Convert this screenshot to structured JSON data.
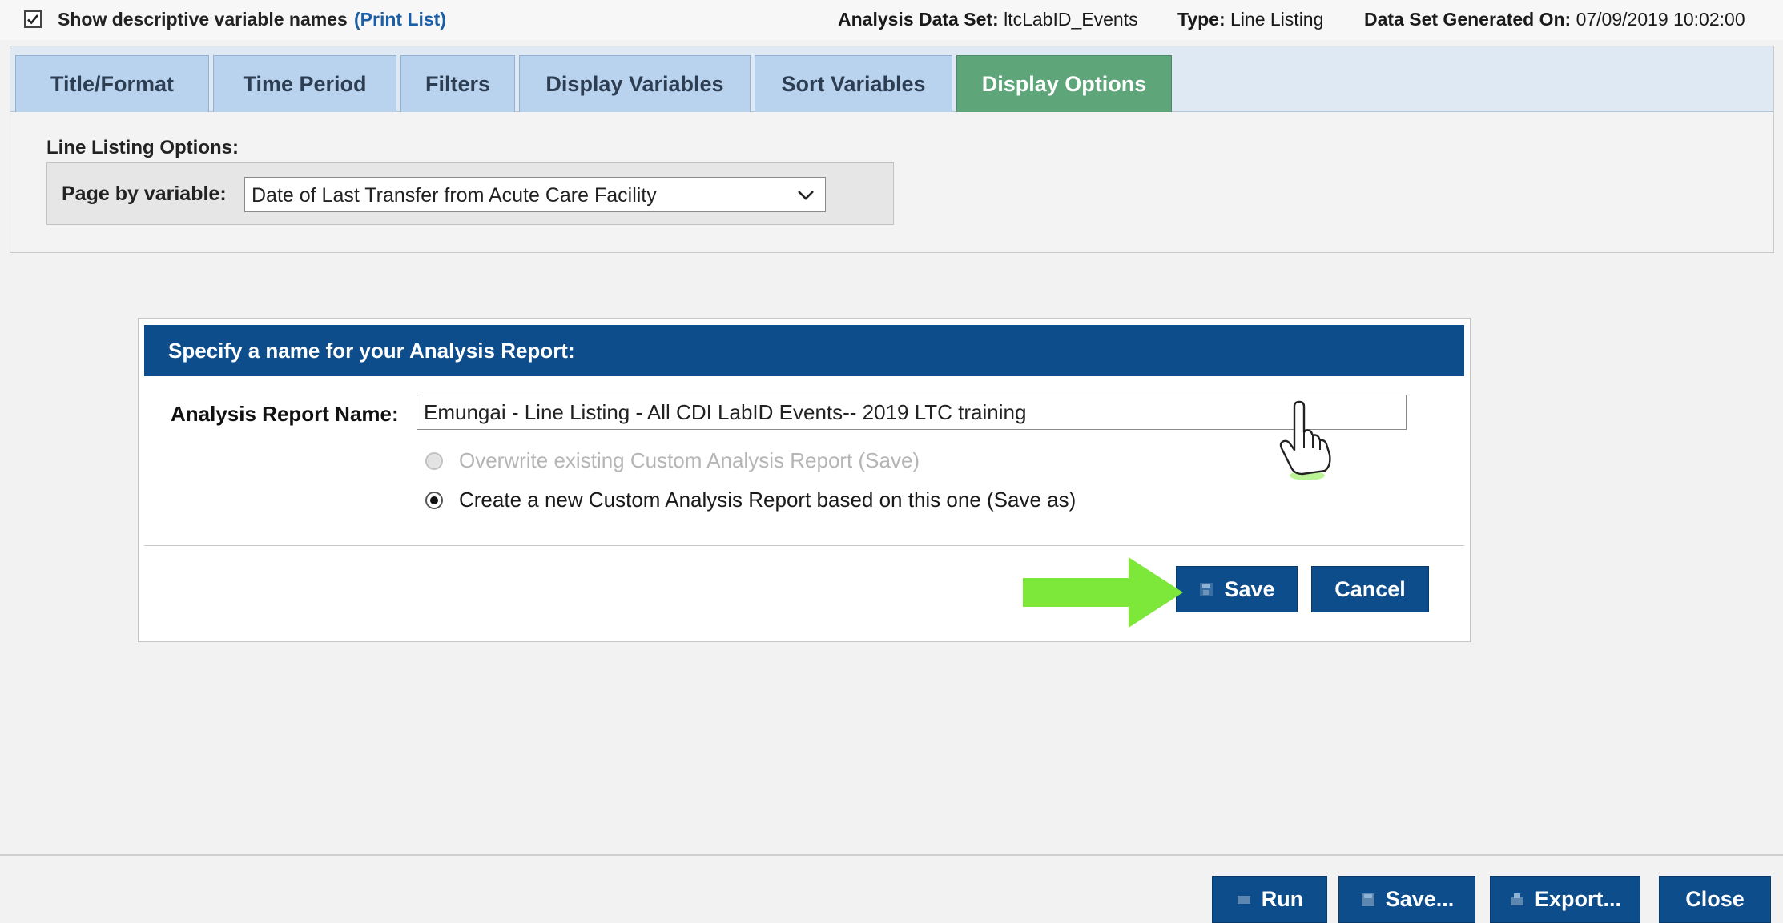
{
  "top_bar": {
    "show_names_label": "Show descriptive variable names",
    "show_names_checked": true,
    "print_list_link": "(Print List)",
    "dataset_label": "Analysis Data Set:",
    "dataset_value": "ltcLabID_Events",
    "type_label": "Type:",
    "type_value": "Line Listing",
    "generated_label": "Data Set Generated On:",
    "generated_value": "07/09/2019 10:02:00"
  },
  "tabs": [
    {
      "label": "Title/Format",
      "active": false
    },
    {
      "label": "Time Period",
      "active": false
    },
    {
      "label": "Filters",
      "active": false
    },
    {
      "label": "Display Variables",
      "active": false
    },
    {
      "label": "Sort Variables",
      "active": false
    },
    {
      "label": "Display Options",
      "active": true
    }
  ],
  "line_listing": {
    "section_label": "Line Listing Options:",
    "page_by_label": "Page by variable:",
    "page_by_value": "Date of Last Transfer from Acute Care Facility"
  },
  "dialog": {
    "header": "Specify a name for your Analysis Report:",
    "name_label": "Analysis Report Name:",
    "name_value": "Emungai - Line Listing - All CDI LabID Events-- 2019 LTC training",
    "option_overwrite": "Overwrite existing Custom Analysis Report (Save)",
    "option_overwrite_enabled": false,
    "option_new": "Create a new Custom Analysis Report based on this one (Save as)",
    "selected_option": "new",
    "save_label": "Save",
    "cancel_label": "Cancel"
  },
  "footer": {
    "run_label": "Run",
    "save_label": "Save...",
    "export_label": "Export...",
    "close_label": "Close"
  },
  "colors": {
    "primary": "#0d4d8c",
    "tab": "#b9d3ee",
    "tab_active": "#5fa57a",
    "link": "#1a5fa6",
    "callout_arrow": "#7ee83a"
  },
  "icons": {
    "checkbox": "check-icon",
    "dropdown": "chevron-down-icon",
    "save": "save-icon",
    "run": "run-icon",
    "export": "export-icon",
    "pointer": "hand-pointer-icon",
    "callout": "arrow-right-icon"
  }
}
